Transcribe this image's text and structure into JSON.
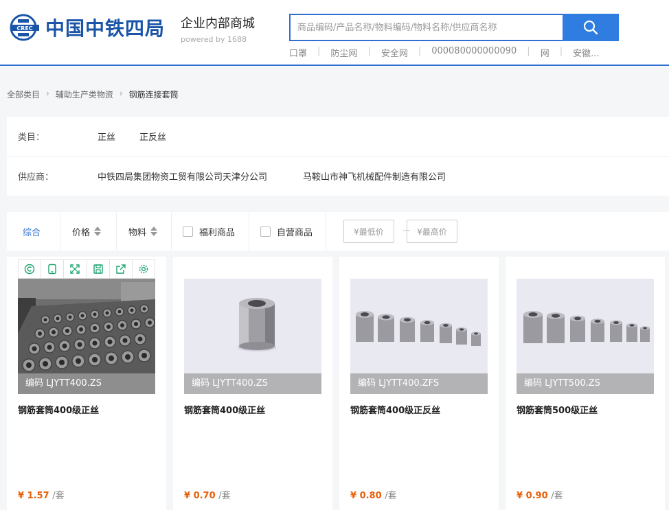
{
  "header": {
    "logo_text": "中国中铁四局",
    "logo_mark_text": "CREC",
    "mall_title": "企业内部商城",
    "mall_subtitle": "powered by 1688",
    "search_placeholder": "商品编码/产品名称/物料编码/物料名称/供应商名称",
    "hot_terms": [
      "口罩",
      "防尘网",
      "安全网",
      "000080000000090",
      "网",
      "安徽..."
    ]
  },
  "breadcrumb": [
    "全部类目",
    "辅助生产类物资",
    "钢筋连接套筒"
  ],
  "filters": {
    "category_label": "类目：",
    "categories": [
      "正丝",
      "正反丝"
    ],
    "supplier_label": "供应商：",
    "suppliers": [
      "中铁四局集团物资工贸有限公司天津分公司",
      "马鞍山市神飞机械配件制造有限公司"
    ]
  },
  "sortbar": {
    "comprehensive": "综合",
    "price": "价格",
    "material": "物料",
    "welfare": "福利商品",
    "self_operated": "自营商品",
    "min_price": "¥最低价",
    "max_price": "¥最高价"
  },
  "products": [
    {
      "code": "编码 LJYTT400.ZS",
      "name": "钢筋套筒400级正丝",
      "price": "¥ 1.57",
      "unit": "/套"
    },
    {
      "code": "编码 LJYTT400.ZS",
      "name": "钢筋套筒400级正丝",
      "price": "¥ 0.70",
      "unit": "/套"
    },
    {
      "code": "编码 LJYTT400.ZFS",
      "name": "钢筋套筒400级正反丝",
      "price": "¥ 0.80",
      "unit": "/套"
    },
    {
      "code": "编码 LJYTT500.ZS",
      "name": "钢筋套筒500级正丝",
      "price": "¥ 0.90",
      "unit": "/套"
    }
  ],
  "colors": {
    "brand": "#1b55a8",
    "accent": "#2f7de1",
    "price": "#e8600a",
    "toolbar_icon": "#19a26b"
  }
}
